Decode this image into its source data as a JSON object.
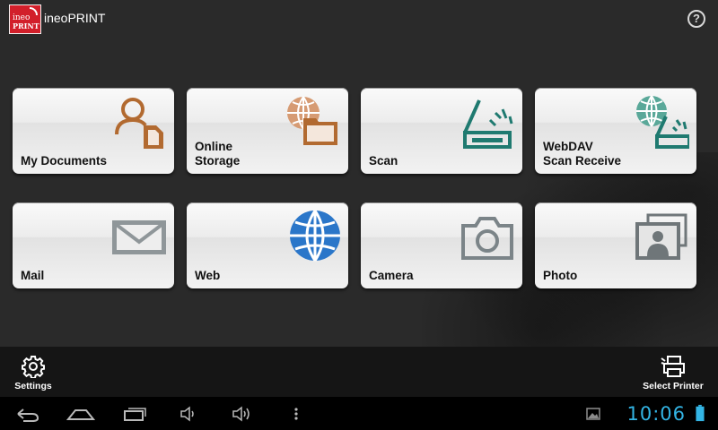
{
  "app": {
    "logo_line1": "ineo",
    "logo_line2": "PRINT",
    "title": "ineoPRINT",
    "help_glyph": "?",
    "brand_color": "#d21f2a"
  },
  "tiles": [
    {
      "label": "My Documents",
      "icon": "user-document-icon"
    },
    {
      "label": "Online\nStorage",
      "icon": "cloud-folder-icon"
    },
    {
      "label": "Scan",
      "icon": "scanner-icon"
    },
    {
      "label": "WebDAV\nScan Receive",
      "icon": "webdav-scan-icon"
    },
    {
      "label": "Mail",
      "icon": "envelope-icon"
    },
    {
      "label": "Web",
      "icon": "globe-icon"
    },
    {
      "label": "Camera",
      "icon": "camera-icon"
    },
    {
      "label": "Photo",
      "icon": "photo-icon"
    }
  ],
  "actionbar": {
    "settings_label": "Settings",
    "select_printer_label": "Select Printer"
  },
  "system": {
    "time": "10:06",
    "accent_color": "#33b5e5"
  }
}
